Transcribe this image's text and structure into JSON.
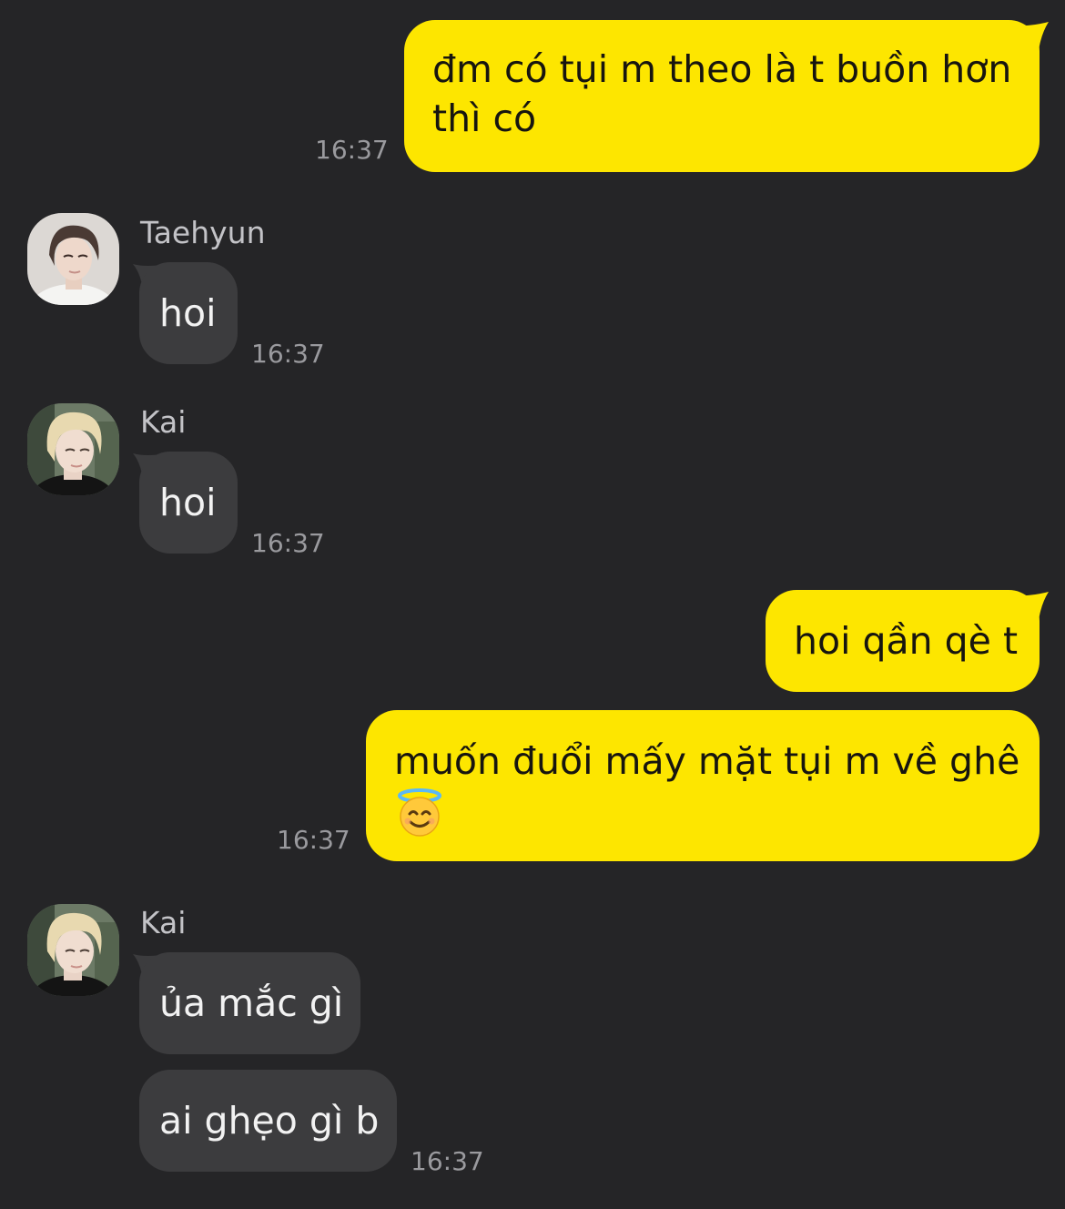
{
  "colors": {
    "background": "#252527",
    "my_bubble": "#FDE600",
    "other_bubble": "#3C3C3E",
    "timestamp": "#9A9A9E",
    "sender_name": "#C3C3C7"
  },
  "messages": [
    {
      "from": "me",
      "lines": [
        "đm có tụi m theo là t buồn hơn",
        "thì có"
      ],
      "time": "16:37"
    },
    {
      "from": "other",
      "sender": "Taehyun",
      "avatar": "avatar-taehyun",
      "text": "hoi",
      "time": "16:37"
    },
    {
      "from": "other",
      "sender": "Kai",
      "avatar": "avatar-kai",
      "text": "hoi",
      "time": "16:37"
    },
    {
      "from": "me",
      "text": "hoi qần qè t"
    },
    {
      "from": "me",
      "lines": [
        "muốn đuổi mấy mặt tụi m về ghê"
      ],
      "emoji": "smiling-face-with-halo-icon",
      "time": "16:37"
    },
    {
      "from": "other",
      "sender": "Kai",
      "avatar": "avatar-kai",
      "text": "ủa mắc gì"
    },
    {
      "from": "other",
      "text": "ai ghẹo gì b",
      "time": "16:37"
    }
  ]
}
